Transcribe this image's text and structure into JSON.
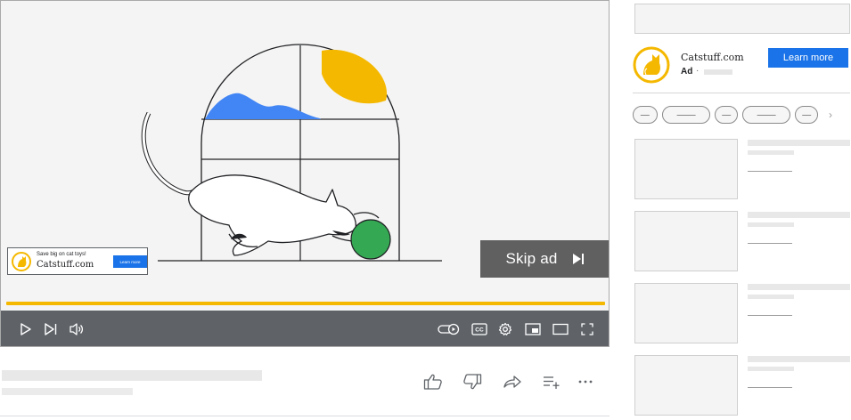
{
  "player": {
    "skip_label": "Skip ad",
    "overlay_ad": {
      "headline": "Save big on cat toys!",
      "advertiser": "Catstuff.com",
      "cta": "Learn more"
    },
    "progress_fraction": 1.0,
    "progress_color": "#f5b800",
    "controls_left": [
      "play-icon",
      "next-icon",
      "volume-icon"
    ],
    "controls_right": [
      "autoplay-toggle-icon",
      "captions-icon",
      "settings-icon",
      "miniplayer-icon",
      "theater-mode-icon",
      "fullscreen-icon"
    ]
  },
  "video_actions": [
    "like-icon",
    "dislike-icon",
    "share-icon",
    "save-to-playlist-icon",
    "more-icon"
  ],
  "sidebar": {
    "ad": {
      "advertiser": "Catstuff.com",
      "badge": "Ad",
      "separator": "·",
      "cta": "Learn more",
      "cta_color": "#1a73e8"
    },
    "chips_next": "›",
    "recommendations": [
      {},
      {},
      {},
      {}
    ]
  },
  "colors": {
    "brand_yellow": "#f5b800",
    "ball_green": "#34a853",
    "cloud_blue": "#4285f4",
    "control_bar": "#5f6368"
  }
}
